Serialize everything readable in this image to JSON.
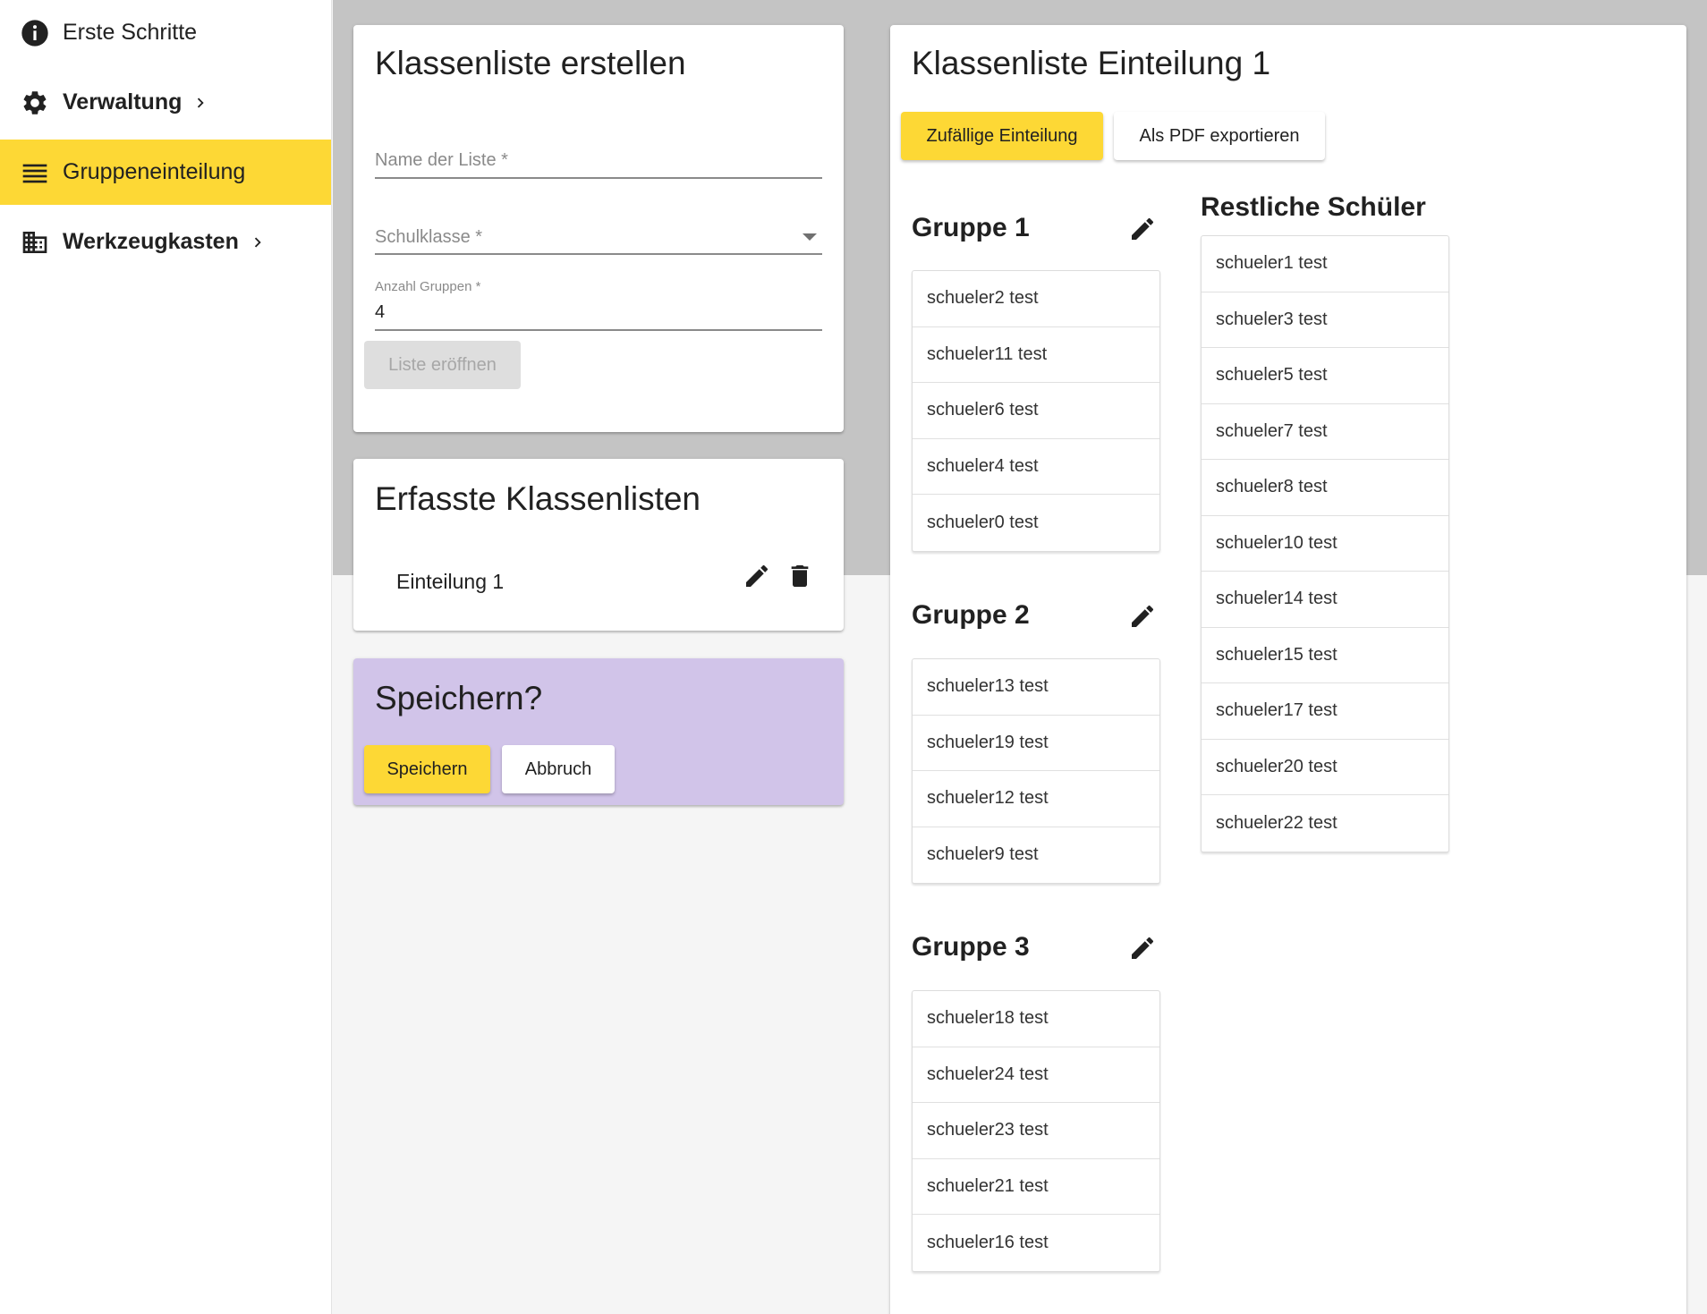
{
  "sidebar": {
    "items": [
      {
        "label": "Erste Schritte",
        "icon": "info-icon"
      },
      {
        "label": "Verwaltung",
        "icon": "gear-icon"
      },
      {
        "label": "Gruppeneinteilung",
        "icon": "menu-lines-icon"
      },
      {
        "label": "Werkzeugkasten",
        "icon": "building-icon"
      }
    ]
  },
  "create_card": {
    "title": "Klassenliste erstellen",
    "name_placeholder": "Name der Liste *",
    "class_placeholder": "Schulklasse *",
    "groups_label": "Anzahl Gruppen *",
    "groups_value": "4",
    "open_button": "Liste eröffnen"
  },
  "lists_card": {
    "title": "Erfasste Klassenlisten",
    "items": [
      {
        "label": "Einteilung 1"
      }
    ]
  },
  "save_card": {
    "title": "Speichern?",
    "save_button": "Speichern",
    "cancel_button": "Abbruch"
  },
  "class_card": {
    "title": "Klassenliste Einteilung 1",
    "random_button": "Zufällige Einteilung",
    "pdf_button": "Als PDF exportieren",
    "groups": [
      {
        "name": "Gruppe 1",
        "students": [
          "schueler2 test",
          "schueler11 test",
          "schueler6 test",
          "schueler4 test",
          "schueler0 test"
        ]
      },
      {
        "name": "Gruppe 2",
        "students": [
          "schueler13 test",
          "schueler19 test",
          "schueler12 test",
          "schueler9 test"
        ]
      },
      {
        "name": "Gruppe 3",
        "students": [
          "schueler18 test",
          "schueler24 test",
          "schueler23 test",
          "schueler21 test",
          "schueler16 test"
        ]
      }
    ],
    "remaining_title": "Restliche Schüler",
    "remaining": [
      "schueler1 test",
      "schueler3 test",
      "schueler5 test",
      "schueler7 test",
      "schueler8 test",
      "schueler10 test",
      "schueler14 test",
      "schueler15 test",
      "schueler17 test",
      "schueler20 test",
      "schueler22 test"
    ]
  },
  "colors": {
    "accent": "#fdd835",
    "save_card_bg": "#d1c4e9",
    "band_gray": "#c4c4c4"
  }
}
